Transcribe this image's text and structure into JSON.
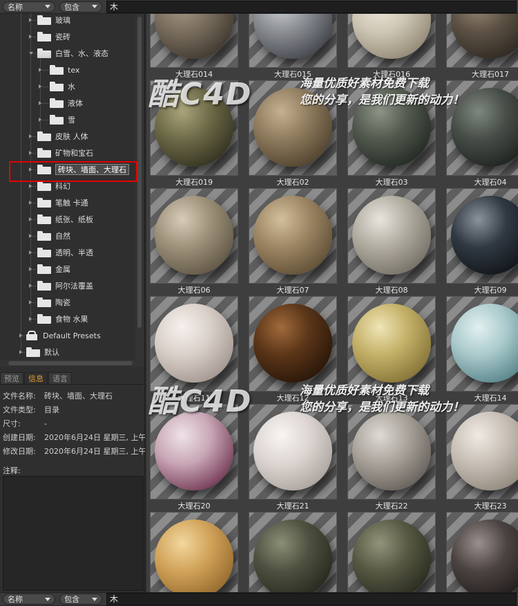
{
  "filter": {
    "field": "名称",
    "mode": "包含",
    "query": "木"
  },
  "tree": [
    {
      "label": "玻璃",
      "depth": 2,
      "type": "folder"
    },
    {
      "label": "瓷砖",
      "depth": 2,
      "type": "folder"
    },
    {
      "label": "白雪、水、液态",
      "depth": 2,
      "type": "folder-open",
      "expanded": true
    },
    {
      "label": "tex",
      "depth": 3,
      "type": "folder"
    },
    {
      "label": "水",
      "depth": 3,
      "type": "folder"
    },
    {
      "label": "液体",
      "depth": 3,
      "type": "folder"
    },
    {
      "label": "雪",
      "depth": 3,
      "type": "folder"
    },
    {
      "label": "皮肤 人体",
      "depth": 2,
      "type": "folder"
    },
    {
      "label": "矿物和宝石",
      "depth": 2,
      "type": "folder"
    },
    {
      "label": "砖块、墙面、大理石",
      "depth": 2,
      "type": "folder",
      "selected": true
    },
    {
      "label": "科幻",
      "depth": 2,
      "type": "folder"
    },
    {
      "label": "笔触 卡通",
      "depth": 2,
      "type": "folder"
    },
    {
      "label": "纸张、纸板",
      "depth": 2,
      "type": "folder"
    },
    {
      "label": "自然",
      "depth": 2,
      "type": "folder"
    },
    {
      "label": "透明、半透",
      "depth": 2,
      "type": "folder"
    },
    {
      "label": "金属",
      "depth": 2,
      "type": "folder"
    },
    {
      "label": "阿尔法覆盖",
      "depth": 2,
      "type": "folder"
    },
    {
      "label": "陶瓷",
      "depth": 2,
      "type": "folder"
    },
    {
      "label": "食物 水果",
      "depth": 2,
      "type": "folder"
    },
    {
      "label": "Default Presets",
      "depth": 1,
      "type": "lock"
    },
    {
      "label": "默认",
      "depth": 1,
      "type": "folder"
    }
  ],
  "tabs": [
    "预览",
    "信息",
    "语言"
  ],
  "active_tab": "信息",
  "info": {
    "name_label": "文件名称:",
    "name": "砖块、墙面、大理石",
    "type_label": "文件类型:",
    "type": "目录",
    "size_label": "尺寸:",
    "size": "-",
    "created_label": "创建日期:",
    "created": "2020年6月24日 星期三, 上午",
    "modified_label": "修改日期:",
    "modified": "2020年6月24日 星期三, 上午",
    "notes_label": "注释:"
  },
  "materials": [
    {
      "name": "大理石014",
      "colors": [
        "#7a6e5e",
        "#3a332b",
        "#a89a86"
      ]
    },
    {
      "name": "大理石015",
      "colors": [
        "#8b8e93",
        "#3c3f45",
        "#cfd2d6"
      ]
    },
    {
      "name": "大理石016",
      "colors": [
        "#cfc7b5",
        "#8c8270",
        "#efe9dc"
      ]
    },
    {
      "name": "大理石017",
      "colors": [
        "#5d5245",
        "#2a241e",
        "#9b8c78"
      ]
    },
    {
      "name": "大理石019",
      "colors": [
        "#6d6a48",
        "#2e2d1c",
        "#a9a47a"
      ]
    },
    {
      "name": "大理石02",
      "colors": [
        "#8e7b5d",
        "#4a3d2a",
        "#c5b192"
      ]
    },
    {
      "name": "大理石03",
      "colors": [
        "#51594e",
        "#1f2520",
        "#8c9487"
      ]
    },
    {
      "name": "大理石04",
      "colors": [
        "#464d47",
        "#1b1f1c",
        "#7e877f"
      ]
    },
    {
      "name": "大理石06",
      "colors": [
        "#9d917a",
        "#5b513f",
        "#d7ccb7"
      ]
    },
    {
      "name": "大理石07",
      "colors": [
        "#9d8663",
        "#5a4a33",
        "#d3c09d"
      ]
    },
    {
      "name": "大理石08",
      "colors": [
        "#b1aca0",
        "#6f6a60",
        "#e8e5de"
      ]
    },
    {
      "name": "大理石09",
      "colors": [
        "#303842",
        "#0f1216",
        "#8a939c"
      ]
    },
    {
      "name": "大理石11",
      "colors": [
        "#d9cfc9",
        "#9d918a",
        "#f6f1ee"
      ]
    },
    {
      "name": "大理石12",
      "colors": [
        "#5a3518",
        "#241307",
        "#a06a3c"
      ]
    },
    {
      "name": "大理石13",
      "colors": [
        "#c3b068",
        "#7e6d32",
        "#efe5b5"
      ]
    },
    {
      "name": "大理石14",
      "colors": [
        "#a9c9cb",
        "#4f7d82",
        "#e2f0f0"
      ]
    },
    {
      "name": "大理石20",
      "colors": [
        "#c9a7b6",
        "#6b2f4c",
        "#eee3e8"
      ]
    },
    {
      "name": "大理石21",
      "colors": [
        "#ddd6d2",
        "#a59e99",
        "#f8f5f3"
      ]
    },
    {
      "name": "大理石22",
      "colors": [
        "#a9a39b",
        "#5e5953",
        "#dedad5"
      ]
    },
    {
      "name": "大理石23",
      "colors": [
        "#c8c0b6",
        "#8c8378",
        "#eeeae4"
      ]
    },
    {
      "name": "",
      "colors": [
        "#d1a35a",
        "#8f6427",
        "#f2d79e"
      ]
    },
    {
      "name": "",
      "colors": [
        "#4e5140",
        "#22241a",
        "#8b8e75"
      ]
    },
    {
      "name": "",
      "colors": [
        "#575943",
        "#25261b",
        "#92947a"
      ]
    },
    {
      "name": "",
      "colors": [
        "#4b4341",
        "#1d1918",
        "#9a908d"
      ]
    }
  ],
  "watermark": {
    "logo": "酷C4D",
    "line1": "海量优质好素材免费下载",
    "line2": "您的分享，是我们更新的动力！"
  },
  "colors": {
    "accent_tab": "#e89a2c",
    "highlight": "#e60000"
  }
}
